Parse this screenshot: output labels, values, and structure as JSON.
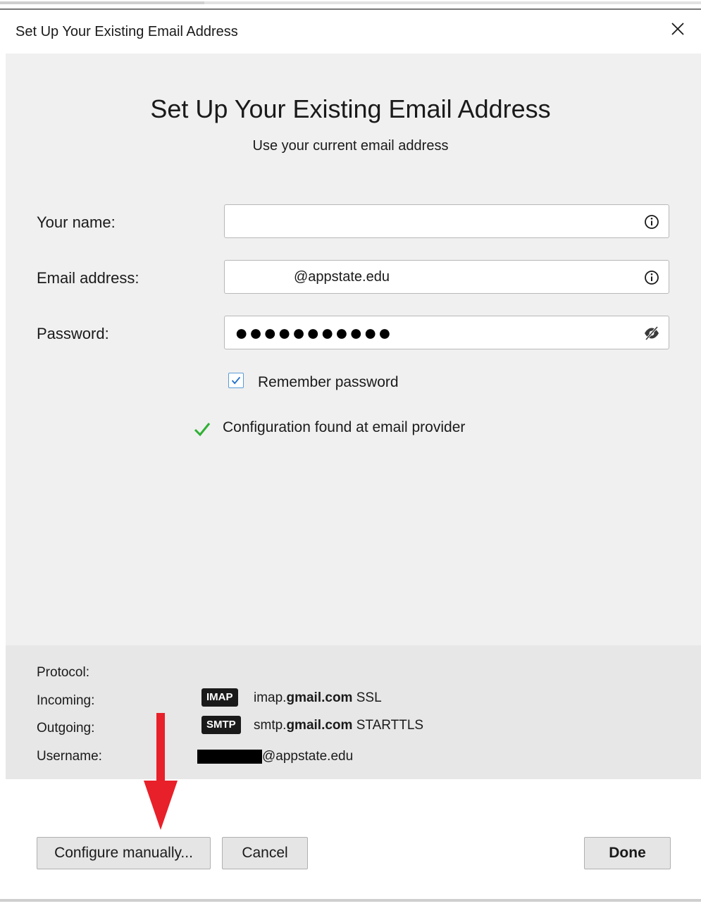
{
  "window": {
    "title": "Set Up Your Existing Email Address"
  },
  "header": {
    "heading": "Set Up Your Existing Email Address",
    "subheading": "Use your current email address"
  },
  "form": {
    "name_label": "Your name:",
    "email_label": "Email address:",
    "email_value": "@appstate.edu",
    "password_label": "Password:",
    "password_dots": "●●●●●●●●●●●",
    "remember_label": "Remember password",
    "remember_checked": true,
    "status": "Configuration found at email provider"
  },
  "config": {
    "protocol_label": "Protocol:",
    "incoming_label": "Incoming:",
    "outgoing_label": "Outgoing:",
    "username_label": "Username:",
    "incoming": {
      "badge": "IMAP",
      "host_pre": "imap.",
      "host_bold": "gmail.com",
      "security": "SSL"
    },
    "outgoing": {
      "badge": "SMTP",
      "host_pre": "smtp.",
      "host_bold": "gmail.com",
      "security": "STARTTLS"
    },
    "username_value": "@appstate.edu"
  },
  "buttons": {
    "configure": "Configure manually...",
    "cancel": "Cancel",
    "done": "Done"
  },
  "colors": {
    "panel": "#f0f0f0",
    "info_panel": "#e7e7e7",
    "check_green": "#2fb034",
    "arrow_red": "#e8202a"
  }
}
